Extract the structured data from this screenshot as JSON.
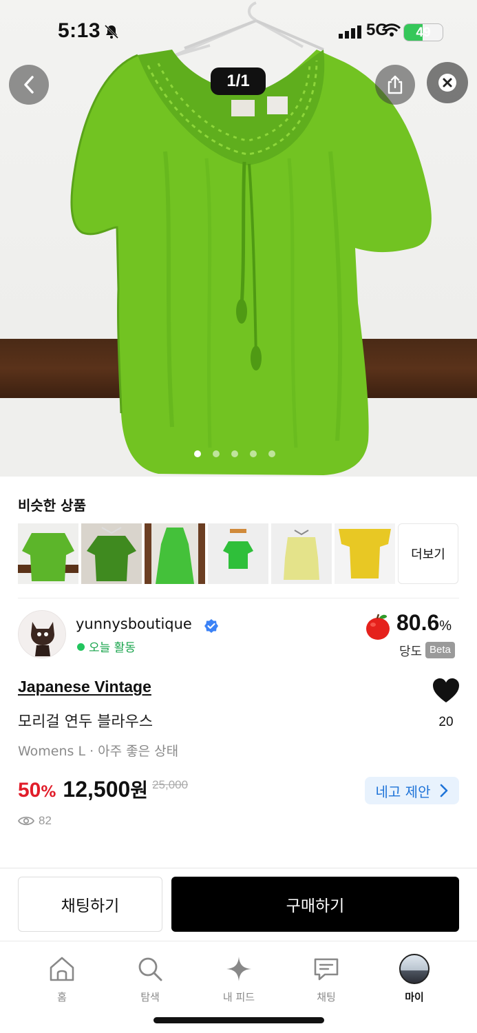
{
  "status_bar": {
    "time": "5:13",
    "network": "5G",
    "battery": "49",
    "battery_level": 0.49
  },
  "gallery": {
    "counter": "1/1",
    "dots_total": 5,
    "dots_active": 0,
    "icons": {
      "back": "chevron-left-icon",
      "share": "share-icon",
      "close": "close-icon"
    }
  },
  "similar": {
    "title": "비슷한 상품",
    "more_label": "더보기",
    "thumbs": [
      {
        "color": "#5cb52a"
      },
      {
        "color": "#3f8a1f"
      },
      {
        "color": "#44c13a"
      },
      {
        "color": "#2fbf3a"
      },
      {
        "color": "#e4e38a"
      },
      {
        "color": "#e8c824"
      }
    ]
  },
  "seller": {
    "name": "yunnysboutique",
    "status": "오늘 활동",
    "score": "80.6",
    "score_unit": "%",
    "score_label": "당도",
    "beta_label": "Beta"
  },
  "product": {
    "brand": "Japanese Vintage",
    "name": "모리걸 연두 블라우스",
    "meta": "Womens L · 아주 좋은 상태",
    "discount": "50",
    "discount_unit": "%",
    "price": "12,500",
    "currency": "원",
    "original_price": "25,000",
    "offer_label": "네고 제안",
    "likes": "20",
    "views": "82"
  },
  "actions": {
    "chat_label": "채팅하기",
    "buy_label": "구매하기"
  },
  "nav": {
    "items": [
      {
        "label": "홈",
        "icon": "home-icon"
      },
      {
        "label": "탐색",
        "icon": "search-icon"
      },
      {
        "label": "내 피드",
        "icon": "sparkle-icon"
      },
      {
        "label": "채팅",
        "icon": "chat-icon"
      },
      {
        "label": "마이",
        "icon": "profile-avatar"
      }
    ],
    "active_index": 4
  },
  "colors": {
    "accent_blue": "#1e73d8",
    "discount_red": "#e11d2a",
    "online_green": "#22c55e",
    "buy_button": "#000000"
  }
}
